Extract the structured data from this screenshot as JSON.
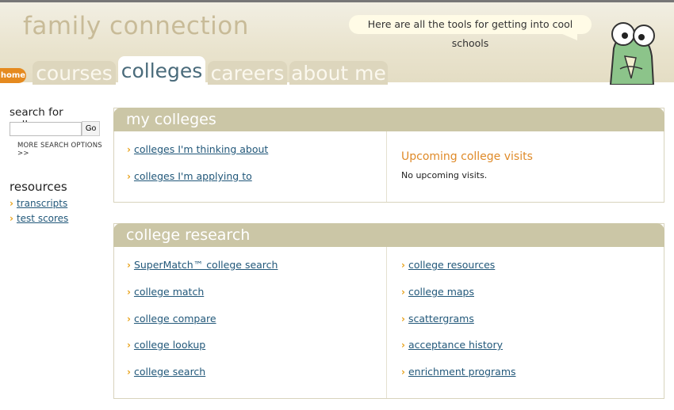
{
  "header": {
    "brand": "family connection",
    "tagline": "Here are all the tools for getting into cool schools",
    "home_label": "home",
    "tabs": {
      "courses": "courses",
      "colleges": "colleges",
      "careers": "careers",
      "about_me": "about me"
    }
  },
  "sidebar": {
    "search_label": "search for colleges:",
    "search_value": "",
    "go_label": "Go",
    "more_search": "MORE SEARCH OPTIONS >>",
    "resources_title": "resources",
    "resources": [
      "transcripts",
      "test scores"
    ]
  },
  "my_colleges": {
    "title": "my colleges",
    "links": [
      "colleges I'm thinking about",
      "colleges I'm applying to"
    ],
    "visits_title": "Upcoming college visits",
    "visits_text": "No upcoming visits."
  },
  "college_research": {
    "title": "college research",
    "left_links": [
      "SuperMatch™ college search",
      "college match",
      "college compare",
      "college lookup",
      "college search"
    ],
    "right_links": [
      "college resources",
      "college maps",
      "scattergrams",
      "acceptance history",
      "enrichment programs"
    ]
  },
  "colors": {
    "accent": "#e58a1f",
    "panel_header": "#cbc6a6",
    "link": "#22587a",
    "chevron": "#e8a31c"
  }
}
